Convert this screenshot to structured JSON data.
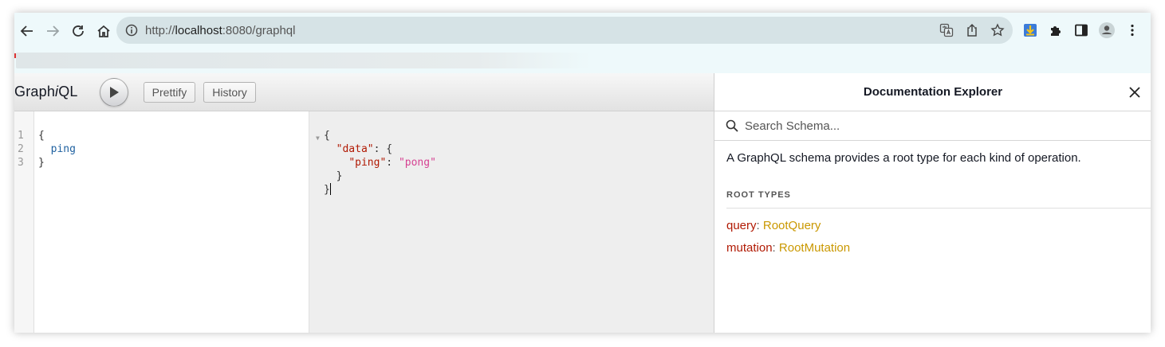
{
  "browser": {
    "url_prefix": "http://",
    "url_host": "localhost",
    "url_rest": ":8080/graphql"
  },
  "graphiql": {
    "title_a": "Graph",
    "title_i": "i",
    "title_b": "QL",
    "prettify_label": "Prettify",
    "history_label": "History"
  },
  "query_editor": {
    "line_numbers": [
      "1",
      "2",
      "3"
    ],
    "lines": [
      "{",
      "ping",
      "}"
    ]
  },
  "result": {
    "open": "{",
    "data_key": "\"data\"",
    "data_open": ": {",
    "ping_key": "\"ping\"",
    "ping_colon": ": ",
    "ping_value": "\"pong\"",
    "inner_close": "}",
    "outer_close": "}"
  },
  "docs": {
    "title": "Documentation Explorer",
    "search_placeholder": "Search Schema...",
    "description": "A GraphQL schema provides a root type for each kind of operation.",
    "section_title": "ROOT TYPES",
    "root_types": [
      {
        "name": "query",
        "type": "RootQuery"
      },
      {
        "name": "mutation",
        "type": "RootMutation"
      }
    ]
  },
  "colors": {
    "field_name": "#b11a04",
    "type_name": "#ca9800",
    "keyword": "#1f61a0",
    "string": "#d64292"
  }
}
